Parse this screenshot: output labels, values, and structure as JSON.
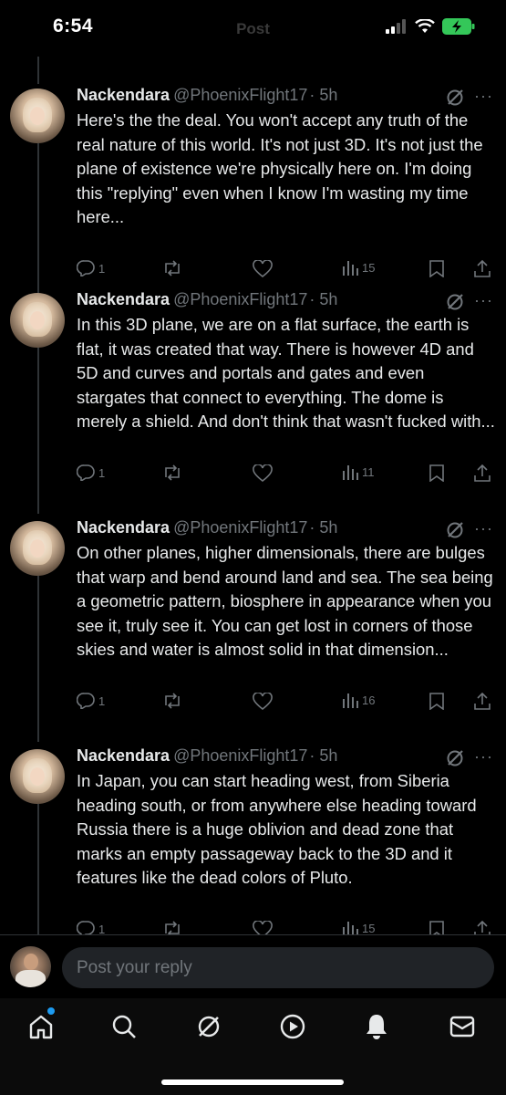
{
  "status_bar": {
    "time": "6:54",
    "ghost_title": "Post"
  },
  "posts": [
    {
      "name": "Nackendara",
      "handle": "@PhoenixFlight17",
      "time": "· 5h",
      "text": "Here's the the deal. You won't accept any truth of the real nature of this world. It's not just 3D. It's not just the plane of existence we're physically here on. I'm doing this \"replying\" even when I know I'm wasting my time here...",
      "replies": "1",
      "views": "15"
    },
    {
      "name": "Nackendara",
      "handle": "@PhoenixFlight17",
      "time": "· 5h",
      "text": "In this 3D plane, we are on a flat surface, the earth is flat, it was created that way. There is however 4D and 5D and curves and portals and gates and even stargates that connect to everything. The dome is merely a shield. And don't think that wasn't fucked with...",
      "replies": "1",
      "views": "11"
    },
    {
      "name": "Nackendara",
      "handle": "@PhoenixFlight17",
      "time": "· 5h",
      "text": "On other planes, higher dimensionals, there are bulges that warp and bend around land and sea. The sea being a geometric pattern, biosphere in appearance when you see it, truly see it. You can get lost in corners of those skies and water is almost solid in that dimension...",
      "replies": "1",
      "views": "16"
    },
    {
      "name": "Nackendara",
      "handle": "@PhoenixFlight17",
      "time": "· 5h",
      "text": "In Japan, you can start heading west, from Siberia heading south, or from anywhere else heading toward Russia there is a huge oblivion and dead zone that marks an empty passageway back to the 3D and it features like the dead colors of Pluto.",
      "replies": "1",
      "views": "15"
    }
  ],
  "reply_bar": {
    "placeholder": "Post your reply"
  },
  "tabs": [
    "home-icon",
    "search-icon",
    "grok-icon",
    "video-icon",
    "notifications-icon",
    "messages-icon"
  ],
  "colors": {
    "background": "#000000",
    "text": "#e7e9ea",
    "muted": "#71767b",
    "accent": "#1d9bf0",
    "battery": "#34c759"
  }
}
